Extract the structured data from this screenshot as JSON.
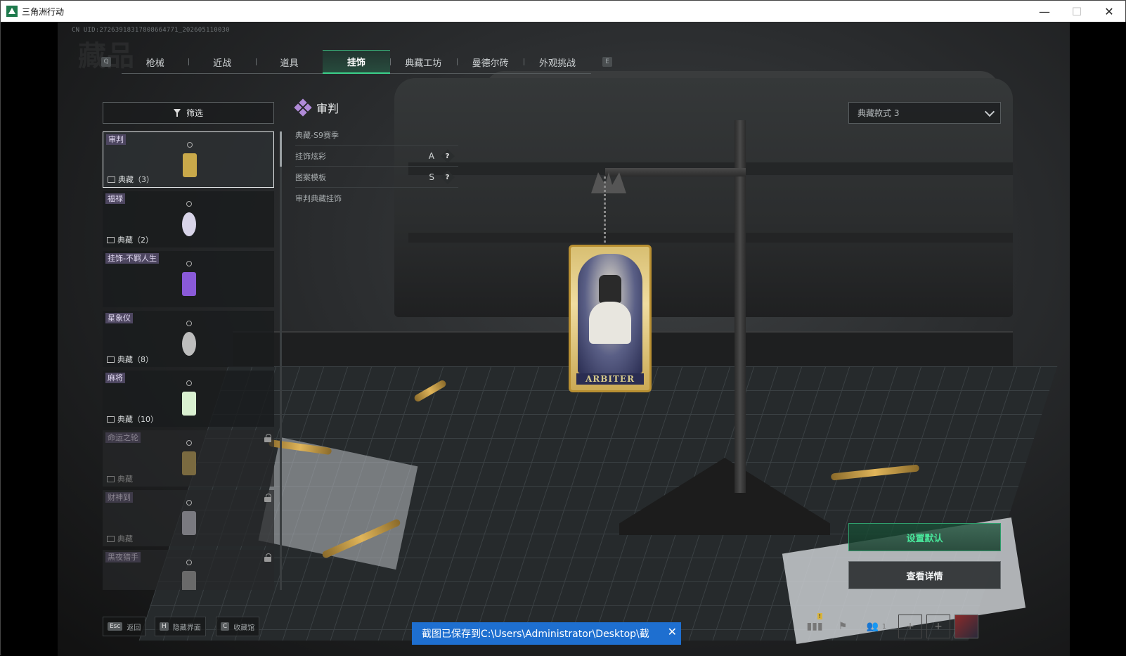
{
  "window": {
    "title": "三角洲行动",
    "minimize": "—",
    "maximize": "☐",
    "close": "✕"
  },
  "uid": "CN UID:27263918317808664771_202605110030",
  "watermark": "藏品",
  "tab_keys": {
    "left": "Q",
    "right": "E"
  },
  "tabs": [
    {
      "label": "枪械",
      "active": false
    },
    {
      "label": "近战",
      "active": false
    },
    {
      "label": "道具",
      "active": false
    },
    {
      "label": "挂饰",
      "active": true
    },
    {
      "label": "典藏工坊",
      "active": false
    },
    {
      "label": "曼德尔砖",
      "active": false
    },
    {
      "label": "外观挑战",
      "active": false
    }
  ],
  "filter": {
    "label": "筛选"
  },
  "items": [
    {
      "tag": "审判",
      "collection": "典藏（3）",
      "selected": true,
      "locked": false,
      "color": "#c9a94a"
    },
    {
      "tag": "福禄",
      "collection": "典藏（2）",
      "selected": false,
      "locked": false,
      "color": "#d8d4e8"
    },
    {
      "tag": "挂饰-不羁人生",
      "collection": "",
      "selected": false,
      "locked": false,
      "color": "#8a5ad8"
    },
    {
      "tag": "星象仪",
      "collection": "典藏（8）",
      "selected": false,
      "locked": false,
      "color": "#bdbdbd"
    },
    {
      "tag": "麻将",
      "collection": "典藏（10）",
      "selected": false,
      "locked": false,
      "color": "#d9f0d0"
    },
    {
      "tag": "命运之轮",
      "collection": "典藏",
      "selected": false,
      "locked": true,
      "color": "#7a6a40"
    },
    {
      "tag": "财神到",
      "collection": "典藏",
      "selected": false,
      "locked": true,
      "color": "#7a7a80"
    },
    {
      "tag": "黑夜猎手",
      "collection": "",
      "selected": false,
      "locked": true,
      "color": "#6a6a6a"
    }
  ],
  "detail": {
    "name": "审判",
    "season": "典藏-S9赛季",
    "rows": [
      {
        "label": "挂饰炫彩",
        "grade": "A",
        "help": "?"
      },
      {
        "label": "图案模板",
        "grade": "S",
        "help": "?"
      }
    ],
    "description": "审判典藏挂饰"
  },
  "charm": {
    "label": "ARBITER"
  },
  "style_select": {
    "value": "典藏款式 3"
  },
  "actions": {
    "set_default": "设置默认",
    "view_detail": "查看详情"
  },
  "bottom_hints": [
    {
      "key": "Esc",
      "label": "返回"
    },
    {
      "key": "H",
      "label": "隐藏界面"
    },
    {
      "key": "C",
      "label": "收藏馆"
    }
  ],
  "toast": {
    "text": "截图已保存到C:\\Users\\Administrator\\Desktop\\截",
    "close": "✕"
  },
  "system": {
    "badge": "!",
    "team_count": "1",
    "plus": "+"
  }
}
